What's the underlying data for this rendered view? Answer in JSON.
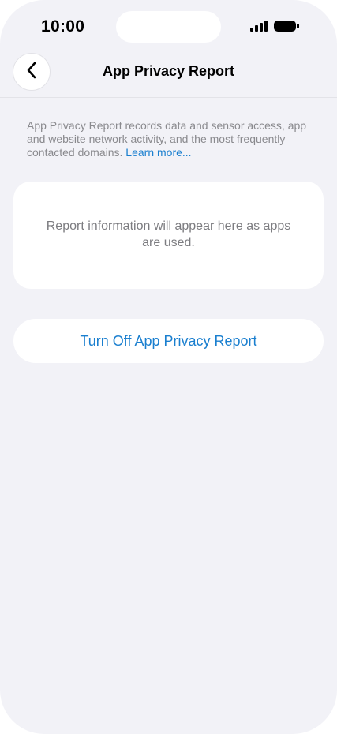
{
  "status_bar": {
    "time": "10:00",
    "icons": [
      "cellular-signal-icon",
      "battery-icon"
    ]
  },
  "nav": {
    "back_icon": "chevron-left-icon",
    "title": "App Privacy Report"
  },
  "description": {
    "text": "App Privacy Report records data and sensor access, app and website network activity, and the most frequently contacted domains.",
    "learn_more": "Learn more..."
  },
  "report_card": {
    "message": "Report information will appear here as apps are used."
  },
  "actions": {
    "turn_off_label": "Turn Off App Privacy Report"
  },
  "colors": {
    "background": "#f2f2f7",
    "card": "#ffffff",
    "accent": "#1a7fcf",
    "secondary_text": "#8a8a8e"
  }
}
